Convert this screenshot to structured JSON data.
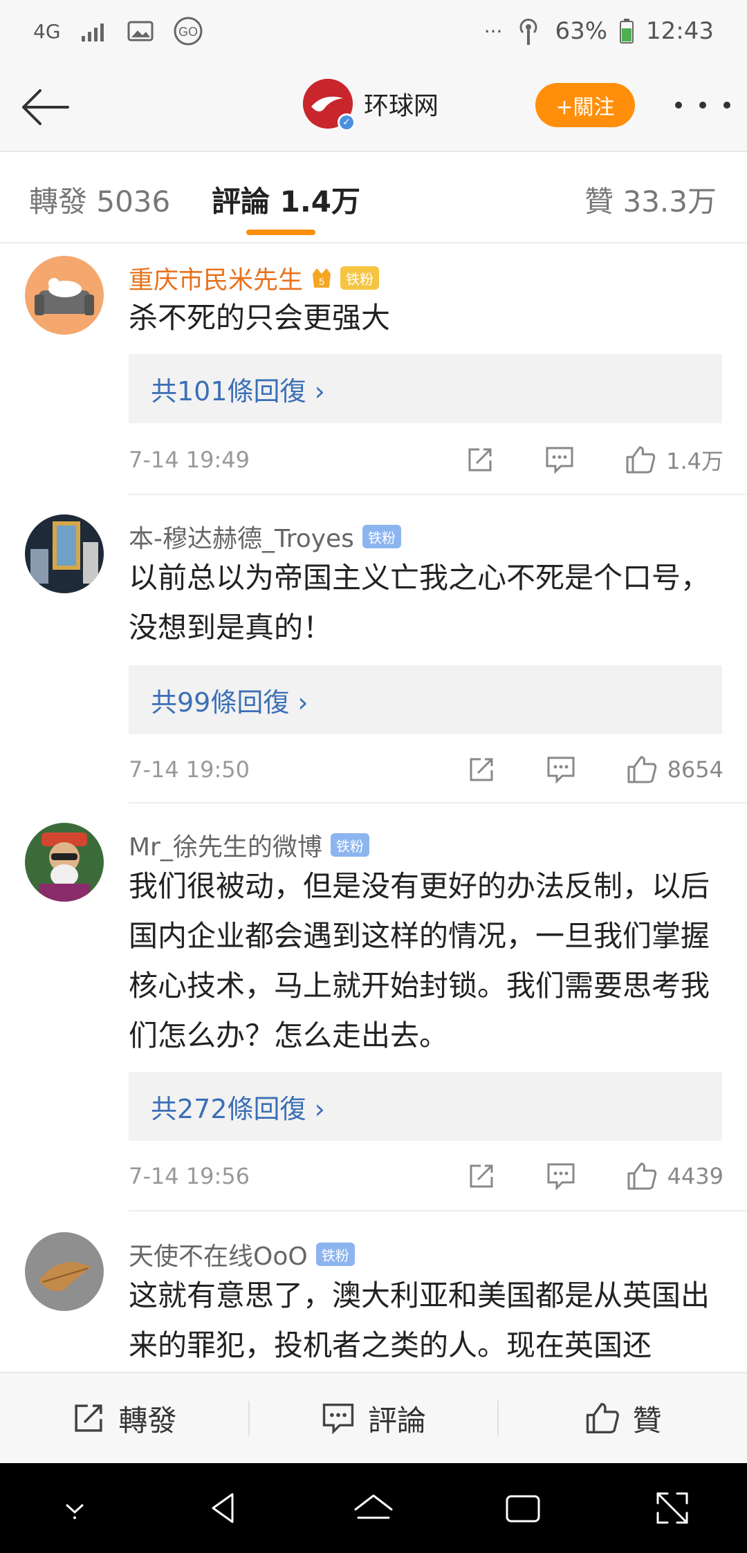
{
  "status": {
    "network": "4G",
    "battery": "63%",
    "time": "12:43",
    "more": "···"
  },
  "header": {
    "account_name": "环球网",
    "follow_label": "+關注"
  },
  "tabs": [
    {
      "label": "轉發 5036",
      "active": false
    },
    {
      "label": "評論 1.4万",
      "active": true
    },
    {
      "label": "贊 33.3万",
      "active": false
    }
  ],
  "comments": [
    {
      "user": "重庆市民米先生",
      "badge": "铁粉",
      "text": "杀不死的只会更强大",
      "replies": "共101條回復 ›",
      "time": "7-14 19:49",
      "likes": "1.4万"
    },
    {
      "user": "本-穆达赫德_Troyes",
      "badge": "铁粉",
      "text": "以前总以为帝国主义亡我之心不死是个口号，没想到是真的！",
      "replies": "共99條回復 ›",
      "time": "7-14 19:50",
      "likes": "8654"
    },
    {
      "user": "Mr_徐先生的微博",
      "badge": "铁粉",
      "text": "我们很被动，但是没有更好的办法反制，以后国内企业都会遇到这样的情况，一旦我们掌握核心技术，马上就开始封锁。我们需要思考我们怎么办？怎么走出去。",
      "replies": "共272條回復 ›",
      "time": "7-14 19:56",
      "likes": "4439"
    },
    {
      "user": "天使不在线OoO",
      "badge": "铁粉",
      "text": "这就有意思了，澳大利亚和美国都是从英国出来的罪犯，投机者之类的人。现在英国还"
    }
  ],
  "bottom_bar": {
    "repost": "轉發",
    "comment": "評論",
    "like": "贊"
  },
  "colors": {
    "accent": "#ff8f0a",
    "link": "#3b6fb6",
    "vip_name": "#e8721c"
  }
}
